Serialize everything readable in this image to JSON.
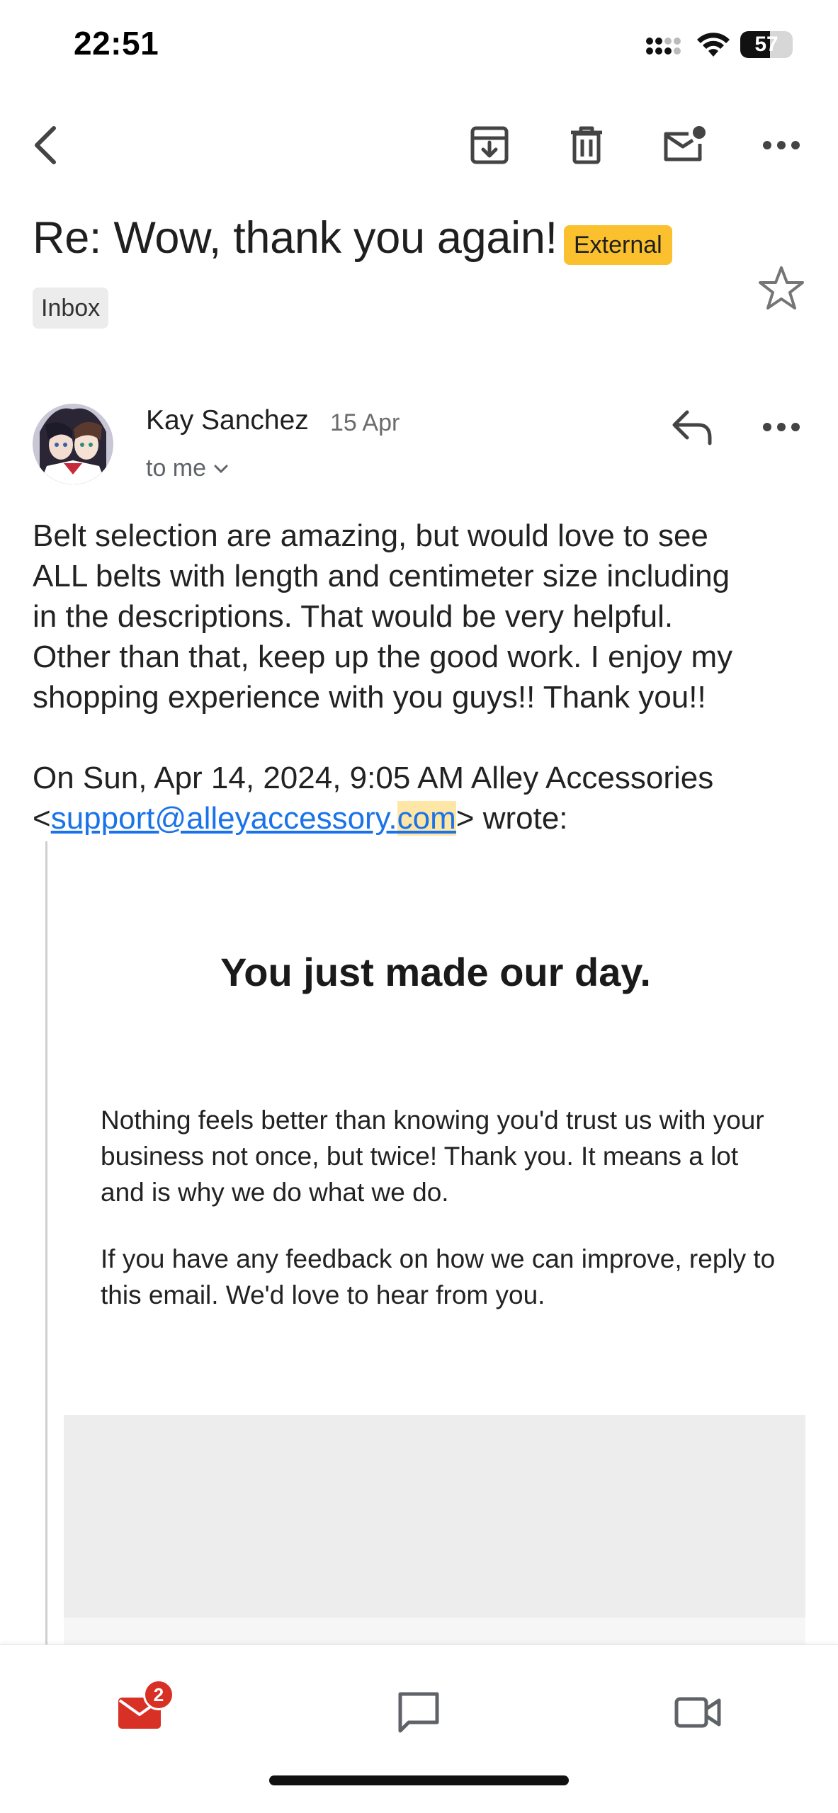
{
  "status_bar": {
    "time": "22:51",
    "battery_text": "57",
    "battery_level_percent": 57
  },
  "toolbar": {
    "icons": [
      "back-arrow-icon",
      "archive-icon",
      "trash-icon",
      "mark-unread-icon",
      "more-horizontal-icon"
    ]
  },
  "email": {
    "subject": "Re: Wow, thank you again!",
    "external_badge": "External",
    "label_chip": "Inbox",
    "sender_name": "Kay Sanchez",
    "date": "15 Apr",
    "recipient": "to me",
    "body_lines": [
      "Belt selection are amazing, but would love to see",
      "ALL belts with length and centimeter size including",
      "in the descriptions. That would be very helpful.",
      "Other than that, keep up the good work. I enjoy my",
      "shopping experience with you guys!! Thank you!!"
    ],
    "quote_intro": "On Sun, Apr 14, 2024, 9:05 AM Alley Accessories",
    "quote_email_prefix": "support@alleyaccessory.",
    "quote_email_suffix": "com",
    "quote_wrote": "wrote:"
  },
  "quoted": {
    "heading": "You just made our day.",
    "paragraph_1": "Nothing feels better than knowing you'd trust us with your business not once, but twice! Thank you. It means a lot and is why we do what we do.",
    "paragraph_2": "If you have any feedback on how we can improve, reply to this email. We'd love to hear from you."
  },
  "bottom_nav": {
    "mail_badge_count": "2",
    "items": [
      "mail-icon",
      "chat-icon",
      "video-icon"
    ]
  },
  "colors": {
    "external_badge": "#fbc02d",
    "link": "#1a73e8",
    "mail_red": "#d93025",
    "highlight": "#fde6a6"
  }
}
